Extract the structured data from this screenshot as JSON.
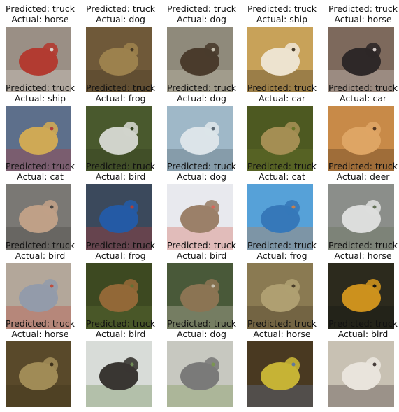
{
  "figure": {
    "cells": [
      {
        "predicted": "Predicted: truck",
        "actual": "Actual: horse",
        "image": "red-fire-truck",
        "bg": "#9a8f86",
        "fg": "#b8291f",
        "accent": "#e8e2dc"
      },
      {
        "predicted": "Predicted: truck",
        "actual": "Actual: dog",
        "image": "frog-on-ground",
        "bg": "#6f5a3a",
        "fg": "#a68a52",
        "accent": "#3e3322"
      },
      {
        "predicted": "Predicted: truck",
        "actual": "Actual: dog",
        "image": "brown-horse",
        "bg": "#8f8a7c",
        "fg": "#3b2a1c",
        "accent": "#cfc8b8"
      },
      {
        "predicted": "Predicted: truck",
        "actual": "Actual: ship",
        "image": "white-fluffy-dog",
        "bg": "#c9a35a",
        "fg": "#f6f2ea",
        "accent": "#2a2520"
      },
      {
        "predicted": "Predicted: truck",
        "actual": "Actual: horse",
        "image": "black-white-dog",
        "bg": "#7d6a5c",
        "fg": "#1d1a1d",
        "accent": "#e5e0de"
      },
      {
        "predicted": "Predicted: truck",
        "actual": "Actual: ship",
        "image": "sailboat",
        "bg": "#5d6f8c",
        "fg": "#e8b64a",
        "accent": "#c4342a"
      },
      {
        "predicted": "Predicted: truck",
        "actual": "Actual: frog",
        "image": "white-horse",
        "bg": "#4a5a2e",
        "fg": "#eeeeee",
        "accent": "#2d3a1c"
      },
      {
        "predicted": "Predicted: truck",
        "actual": "Actual: dog",
        "image": "white-boat",
        "bg": "#9fb9c8",
        "fg": "#e9eef1",
        "accent": "#4b5660"
      },
      {
        "predicted": "Predicted: truck",
        "actual": "Actual: car",
        "image": "frog-on-grass",
        "bg": "#4d5a22",
        "fg": "#b89a5e",
        "accent": "#6c7a2a"
      },
      {
        "predicted": "Predicted: truck",
        "actual": "Actual: car",
        "image": "tan-dog",
        "bg": "#c98a48",
        "fg": "#e3ab6b",
        "accent": "#3a2418"
      },
      {
        "predicted": "Predicted: truck",
        "actual": "Actual: cat",
        "image": "vintage-car",
        "bg": "#7a7874",
        "fg": "#cfa98c",
        "accent": "#3e3a36"
      },
      {
        "predicted": "Predicted: truck",
        "actual": "Actual: bird",
        "image": "blue-car",
        "bg": "#3b4a5c",
        "fg": "#1f5fb5",
        "accent": "#d13a2a"
      },
      {
        "predicted": "Predicted: truck",
        "actual": "Actual: dog",
        "image": "cat-on-snow",
        "bg": "#e8eaee",
        "fg": "#8a6a4c",
        "accent": "#d24a3a"
      },
      {
        "predicted": "Predicted: truck",
        "actual": "Actual: cat",
        "image": "kingfisher",
        "bg": "#56a2d8",
        "fg": "#2f6fb3",
        "accent": "#e0782e"
      },
      {
        "predicted": "Predicted: truck",
        "actual": "Actual: deer",
        "image": "white-dog-on-road",
        "bg": "#8c8e8a",
        "fg": "#eeeeee",
        "accent": "#5a6a4a"
      },
      {
        "predicted": "Predicted: truck",
        "actual": "Actual: bird",
        "image": "cat-indoors",
        "bg": "#b4a89a",
        "fg": "#8d99ae",
        "accent": "#c03a2a"
      },
      {
        "predicted": "Predicted: truck",
        "actual": "Actual: frog",
        "image": "deer",
        "bg": "#3d4a22",
        "fg": "#a5703c",
        "accent": "#6a7a3a"
      },
      {
        "predicted": "Predicted: truck",
        "actual": "Actual: bird",
        "image": "sparrow",
        "bg": "#4a5a3a",
        "fg": "#9a7a5a",
        "accent": "#e2d8cc"
      },
      {
        "predicted": "Predicted: truck",
        "actual": "Actual: frog",
        "image": "frog-closeup",
        "bg": "#8a7a52",
        "fg": "#b7a878",
        "accent": "#3a3020"
      },
      {
        "predicted": "Predicted: truck",
        "actual": "Actual: horse",
        "image": "yellow-bird",
        "bg": "#2c2a1e",
        "fg": "#f0a81e",
        "accent": "#111111"
      },
      {
        "predicted": "Predicted: truck",
        "actual": "Actual: horse",
        "image": "frog",
        "bg": "#5a4a2a",
        "fg": "#b09a60",
        "accent": "#3a2e18"
      },
      {
        "predicted": "Predicted: truck",
        "actual": "Actual: bird",
        "image": "black-horse",
        "bg": "#d8dcd8",
        "fg": "#16120e",
        "accent": "#5a7a3a"
      },
      {
        "predicted": "Predicted: truck",
        "actual": "Actual: dog",
        "image": "grey-horse",
        "bg": "#c7c9c0",
        "fg": "#6a6a6a",
        "accent": "#6a8a3a"
      },
      {
        "predicted": "Predicted: truck",
        "actual": "Actual: horse",
        "image": "yellow-songbird",
        "bg": "#4a3a22",
        "fg": "#e2cf3a",
        "accent": "#6a88b5"
      },
      {
        "predicted": "Predicted: truck",
        "actual": "Actual: bird",
        "image": "white-puppy",
        "bg": "#c9c1b4",
        "fg": "#f1ece6",
        "accent": "#2a2020"
      }
    ]
  }
}
